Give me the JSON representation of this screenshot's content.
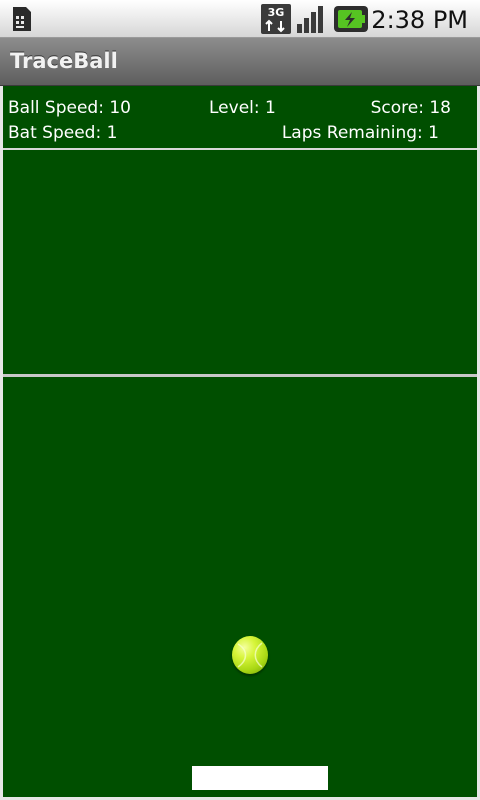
{
  "status_bar": {
    "time": "2:38 PM",
    "network": "3G",
    "icons": [
      "sim-card-icon",
      "3g-network-icon",
      "signal-strength-icon",
      "battery-charging-icon"
    ]
  },
  "app": {
    "title": "TraceBall"
  },
  "hud": {
    "ball_speed": {
      "label": "Ball Speed: ",
      "value": "10"
    },
    "level": {
      "label": "Level: ",
      "value": "1"
    },
    "score": {
      "label": "Score: ",
      "value": "18"
    },
    "bat_speed": {
      "label": "Bat Speed: ",
      "value": "1"
    },
    "laps_remaining": {
      "label": "Laps Remaining: ",
      "value": "1"
    }
  },
  "colors": {
    "field": "#004f00",
    "lines": "#e6e6e6",
    "ball": "#c6ee2a",
    "bat": "#ffffff",
    "hud_text": "#ffffff"
  }
}
